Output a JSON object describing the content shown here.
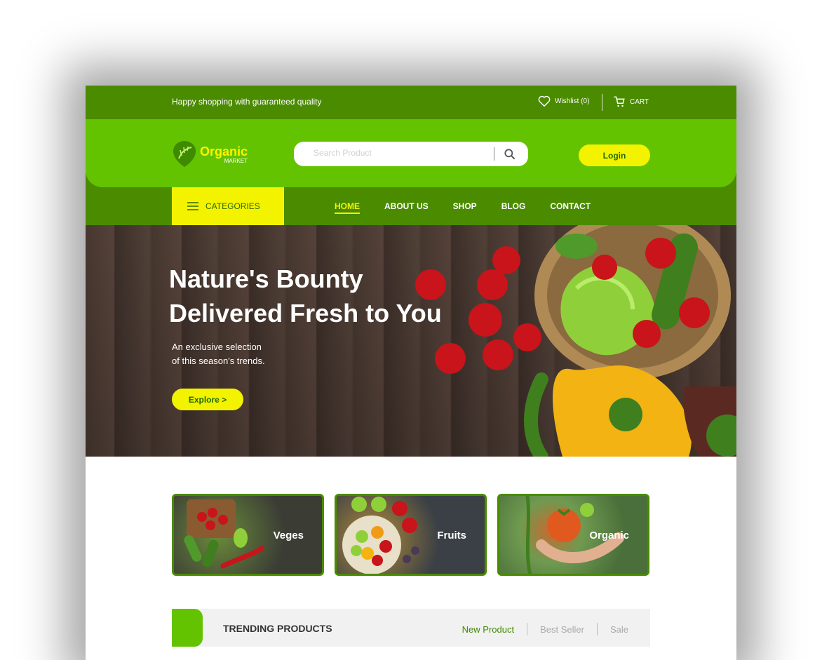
{
  "topbar": {
    "tagline": "Happy shopping with guaranteed quality",
    "wishlist": "Wishlist (0)",
    "cart": "CART"
  },
  "header": {
    "logo_main": "Organic",
    "logo_sub": "MARKET",
    "search_placeholder": "Search Product",
    "login": "Login"
  },
  "nav": {
    "categories": "CATEGORIES",
    "links": [
      "HOME",
      "ABOUT US",
      "SHOP",
      "BLOG",
      "CONTACT"
    ]
  },
  "hero": {
    "title_line1": "Nature's Bounty",
    "title_line2": "Delivered Fresh to You",
    "subtitle_line1": "An exclusive selection",
    "subtitle_line2": "of this season's trends.",
    "cta": "Explore >"
  },
  "categories": [
    "Veges",
    "Fruits",
    "Organic"
  ],
  "trending": {
    "title": "TRENDING PRODUCTS",
    "tabs": [
      "New Product",
      "Best Seller",
      "Sale"
    ]
  },
  "colors": {
    "dark_green": "#4a8b00",
    "bright_green": "#63c300",
    "yellow": "#f3f300"
  }
}
